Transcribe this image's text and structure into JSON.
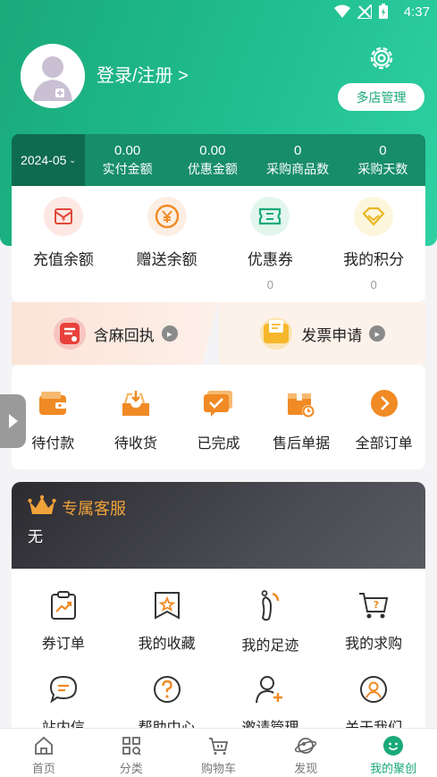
{
  "status_bar": {
    "time": "4:37"
  },
  "profile": {
    "login_label": "登录/注册 >",
    "multi_store_label": "多店管理"
  },
  "stats": {
    "date": "2024-05",
    "items": [
      {
        "value": "0.00",
        "label": "实付金额"
      },
      {
        "value": "0.00",
        "label": "优惠金额"
      },
      {
        "value": "0",
        "label": "采购商品数"
      },
      {
        "value": "0",
        "label": "采购天数"
      }
    ]
  },
  "wallet": [
    {
      "label": "充值余额",
      "value": "",
      "icon": "recharge-icon"
    },
    {
      "label": "赠送余额",
      "value": "",
      "icon": "yen-icon"
    },
    {
      "label": "优惠券",
      "value": "0",
      "icon": "coupon-icon"
    },
    {
      "label": "我的积分",
      "value": "0",
      "icon": "diamond-icon"
    }
  ],
  "banners": [
    {
      "label": "含麻回执"
    },
    {
      "label": "发票申请"
    }
  ],
  "orders": [
    {
      "label": "待付款"
    },
    {
      "label": "待收货"
    },
    {
      "label": "已完成"
    },
    {
      "label": "售后单据"
    },
    {
      "label": "全部订单"
    }
  ],
  "service": {
    "title": "专属客服",
    "value": "无"
  },
  "tools": [
    {
      "label": "券订单"
    },
    {
      "label": "我的收藏"
    },
    {
      "label": "我的足迹"
    },
    {
      "label": "我的求购"
    },
    {
      "label": "站内信"
    },
    {
      "label": "帮助中心"
    },
    {
      "label": "邀请管理"
    },
    {
      "label": "关于我们"
    }
  ],
  "tabbar": [
    {
      "label": "首页"
    },
    {
      "label": "分类"
    },
    {
      "label": "购物车"
    },
    {
      "label": "发现"
    },
    {
      "label": "我的聚创"
    }
  ],
  "colors": {
    "primary": "#1aa97a",
    "accent_orange": "#f08a24",
    "gold": "#f0a23a"
  }
}
